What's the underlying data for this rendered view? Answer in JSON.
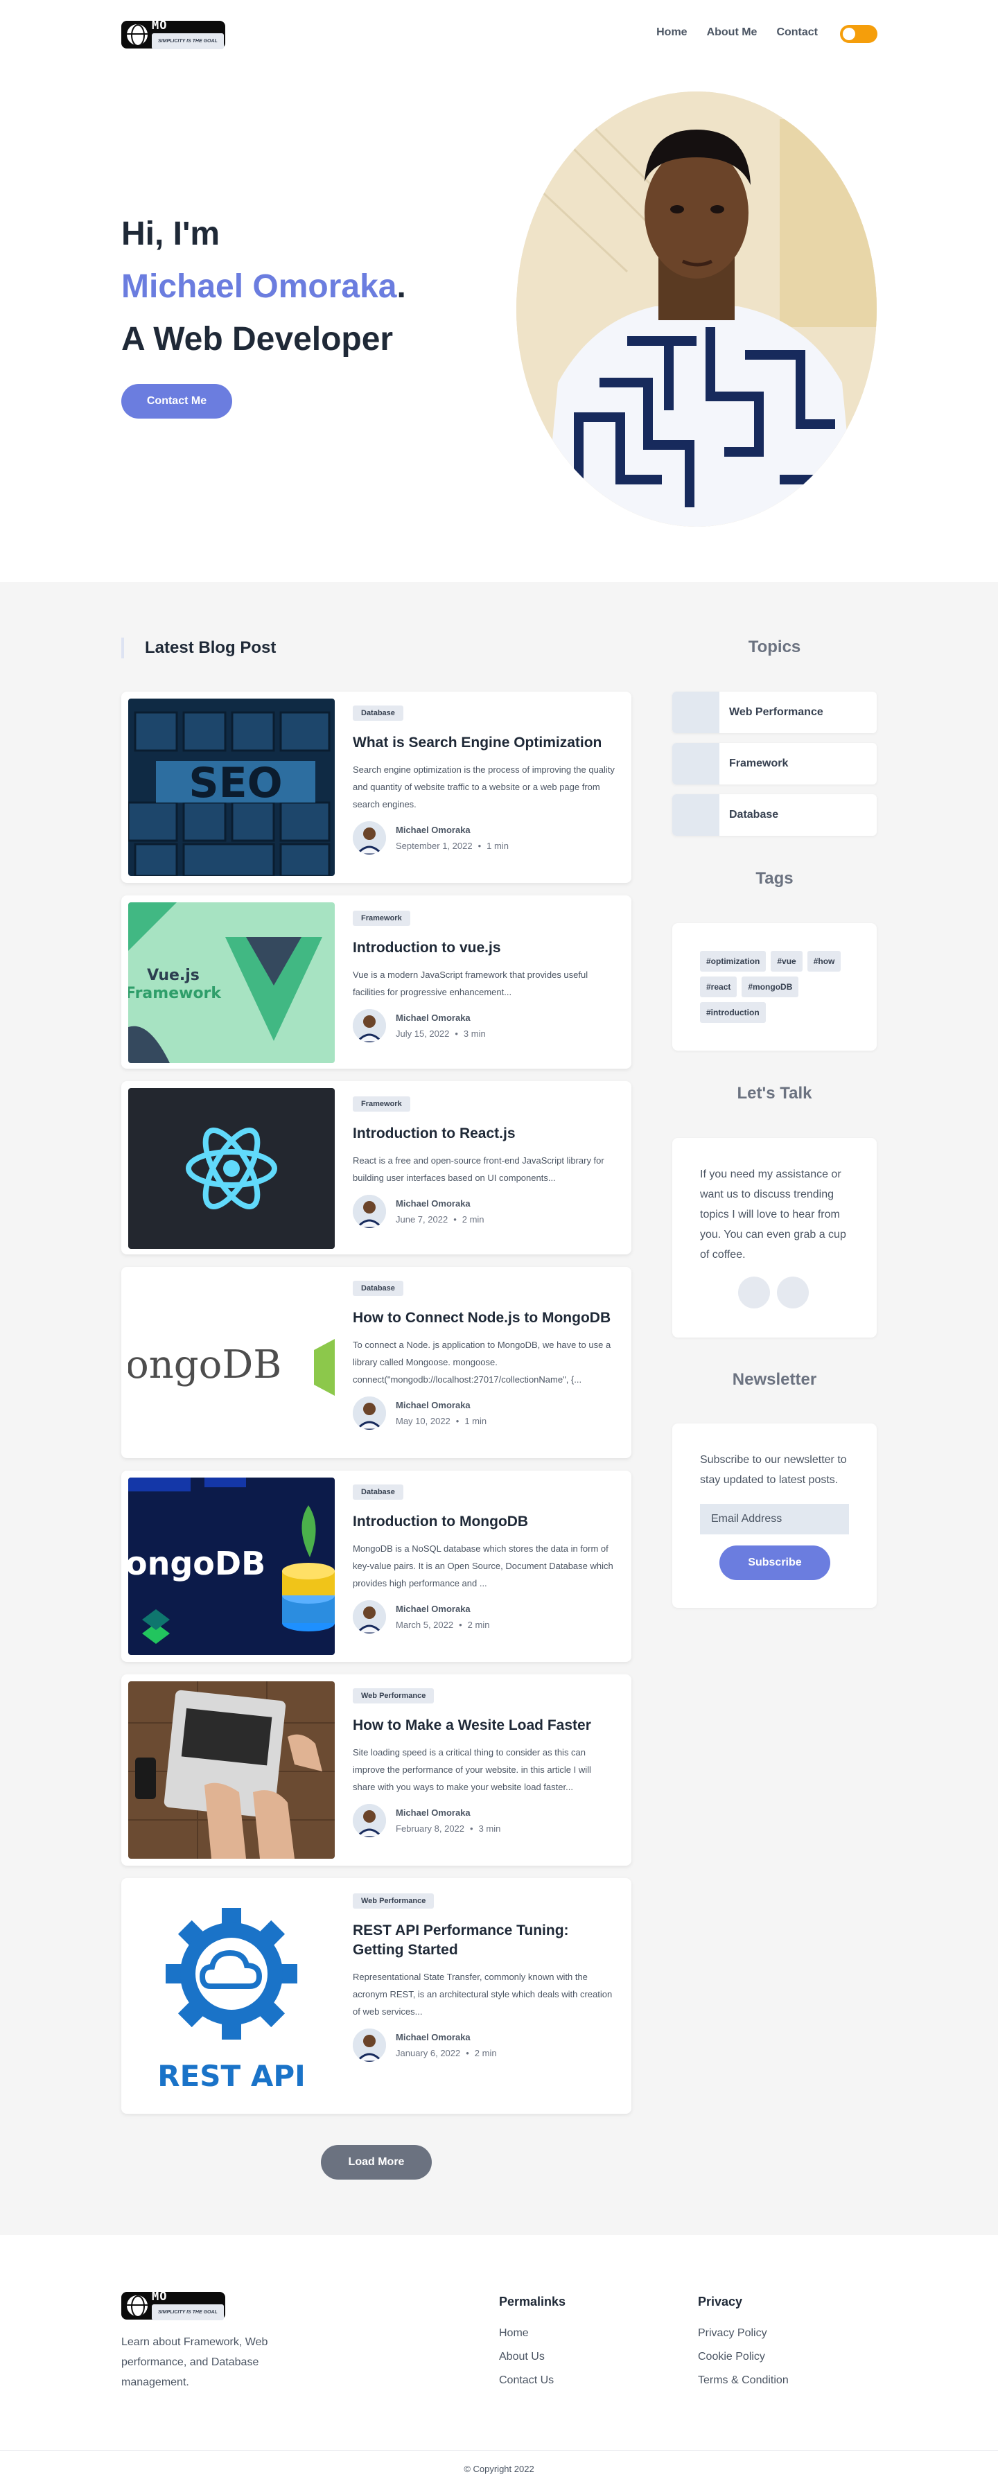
{
  "brand": {
    "logo_text": "MO",
    "logo_tagline": "SIMPLICITY IS THE GOAL"
  },
  "nav": {
    "items": [
      "Home",
      "About Me",
      "Contact"
    ]
  },
  "hero": {
    "greeting": "Hi, I'm",
    "name": "Michael Omoraka",
    "dot": ".",
    "role": "A Web Developer",
    "cta": "Contact Me"
  },
  "blog": {
    "title": "Latest Blog Post",
    "posts": [
      {
        "category": "Database",
        "title": "What is Search Engine Optimization",
        "excerpt": "Search engine optimization is the process of improving the quality and quantity of website traffic to a website or a web page from search engines.",
        "author": "Michael Omoraka",
        "date": "September 1, 2022",
        "read": "1 min",
        "thumb": "seo-keyboard-image"
      },
      {
        "category": "Framework",
        "title": "Introduction to vue.js",
        "excerpt": "Vue is a modern JavaScript framework that provides useful facilities for progressive enhancement...",
        "author": "Michael Omoraka",
        "date": "July 15, 2022",
        "read": "3 min",
        "thumb": "vue-logo-image",
        "thumb_text": [
          "Vue.js",
          "Framework"
        ]
      },
      {
        "category": "Framework",
        "title": "Introduction to React.js",
        "excerpt": "React is a free and open-source front-end JavaScript library for building user interfaces based on UI components...",
        "author": "Michael Omoraka",
        "date": "June 7, 2022",
        "read": "2 min",
        "thumb": "react-logo-image"
      },
      {
        "category": "Database",
        "title": "How to Connect Node.js to MongoDB",
        "excerpt": "To connect a Node. js application to MongoDB, we have to use a library called Mongoose. mongoose. connect(\"mongodb://localhost:27017/collectionName\", {...",
        "author": "Michael Omoraka",
        "date": "May 10, 2022",
        "read": "1 min",
        "thumb": "mongodb-nodejs-image",
        "thumb_text": [
          "ongoDB"
        ]
      },
      {
        "category": "Database",
        "title": "Introduction to MongoDB",
        "excerpt": "MongoDB is a NoSQL database which stores the data in form of key-value pairs. It is an Open Source, Document Database which provides high performance and ...",
        "author": "Michael Omoraka",
        "date": "March 5, 2022",
        "read": "2 min",
        "thumb": "mongodb-dark-image",
        "thumb_text": [
          "ongoDB"
        ]
      },
      {
        "category": "Web Performance",
        "title": "How to Make a Wesite Load Faster",
        "excerpt": "Site loading speed is a critical thing to consider as this can improve the performance of your website. in this article I will share with you ways to make your website load faster...",
        "author": "Michael Omoraka",
        "date": "February 8, 2022",
        "read": "3 min",
        "thumb": "laptop-typing-image"
      },
      {
        "category": "Web Performance",
        "title": "REST API Performance Tuning: Getting Started",
        "excerpt": "Representational State Transfer, commonly known with the acronym REST, is an architectural style which deals with creation of web services...",
        "author": "Michael Omoraka",
        "date": "January 6, 2022",
        "read": "2 min",
        "thumb": "rest-api-gear-image",
        "thumb_text": [
          "REST API"
        ]
      }
    ],
    "load_more": "Load More"
  },
  "sidebar": {
    "topics_title": "Topics",
    "topics": [
      "Web Performance",
      "Framework",
      "Database"
    ],
    "tags_title": "Tags",
    "tags": [
      "#optimization",
      "#vue",
      "#how",
      "#react",
      "#mongoDB",
      "#introduction"
    ],
    "talk_title": "Let's Talk",
    "talk_text": "If you need my assistance or want us to discuss trending topics I will love to hear from you. You can even grab a cup of coffee.",
    "newsletter_title": "Newsletter",
    "newsletter_text": "Subscribe to our newsletter to stay updated to latest posts.",
    "email_placeholder": "Email Address",
    "subscribe": "Subscribe"
  },
  "footer": {
    "description": "Learn about Framework, Web performance, and Database management.",
    "permalinks_title": "Permalinks",
    "permalinks": [
      "Home",
      "About Us",
      "Contact Us"
    ],
    "privacy_title": "Privacy",
    "privacy": [
      "Privacy Policy",
      "Cookie Policy",
      "Terms & Condition"
    ],
    "copyright": "© Copyright 2022"
  },
  "colors": {
    "accent": "#6b7ddf",
    "toggle": "#f59e0b",
    "section_bg": "#f5f5f5",
    "load_more": "#6b7280"
  }
}
